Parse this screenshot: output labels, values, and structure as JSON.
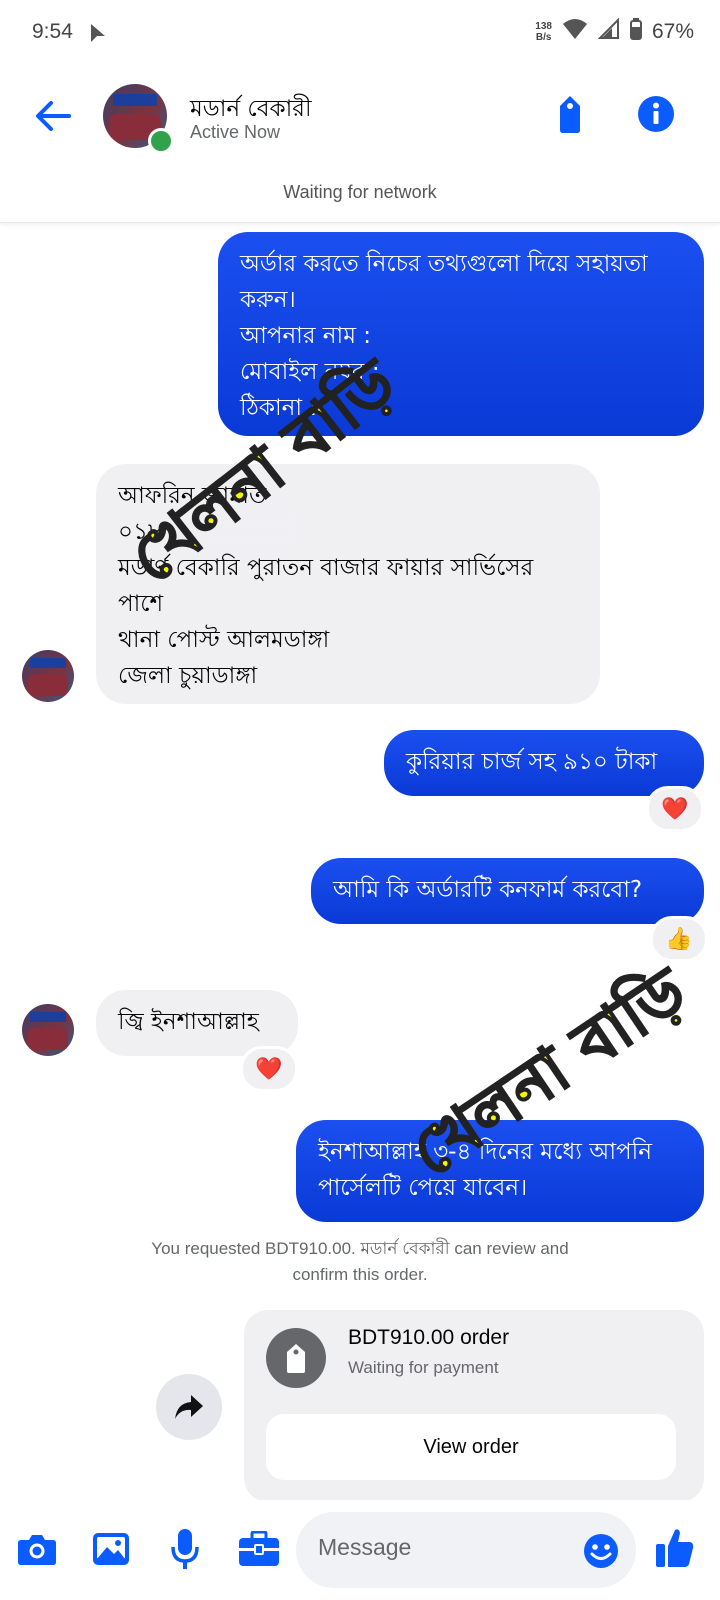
{
  "status_bar": {
    "time": "9:54",
    "net_speed_top": "138",
    "net_speed_bottom": "B/s",
    "battery": "67%"
  },
  "header": {
    "name": "মডার্ন বেকারী",
    "status": "Active Now"
  },
  "network_notice": "Waiting for network",
  "messages": [
    {
      "dir": "out",
      "lines": [
        "অর্ডার করতে নিচের তথ্যগুলো দিয়ে সহায়তা",
        "করুন।",
        "আপনার নাম :",
        "মোবাইল নম্বর :",
        "ঠিকানা :"
      ]
    },
    {
      "dir": "in",
      "lines": [
        "আফরিন জান্নাত",
        "০১৮",
        "মডার্ণ বেকারি পুরাতন বাজার ফায়ার সার্ভিসের",
        "পাশে",
        "থানা পোস্ট আলমডাঙ্গা",
        "জেলা চুয়াডাঙ্গা"
      ]
    },
    {
      "dir": "out",
      "lines": [
        "কুরিয়ার চার্জ সহ ৯১০ টাকা"
      ],
      "reaction": "❤️"
    },
    {
      "dir": "out",
      "lines": [
        "আমি কি অর্ডারটি কনফার্ম করবো?"
      ],
      "reaction": "👍"
    },
    {
      "dir": "in",
      "lines": [
        "জ্বি ইনশাআল্লাহ"
      ],
      "reaction": "❤️"
    },
    {
      "dir": "out",
      "lines": [
        "ইনশাআল্লাহ ৩-৪ দিনের মধ্যে আপনি",
        "পার্সেলটি পেয়ে যাবেন।"
      ]
    }
  ],
  "request_notice": {
    "line1": "You requested BDT910.00. মডার্ন বেকারী can review and",
    "line2": "confirm this order."
  },
  "order_card": {
    "title": "BDT910.00 order",
    "status": "Waiting for payment",
    "button": "View order"
  },
  "watermark_text": "খেলনা বাড়ি",
  "composer": {
    "placeholder": "Message"
  },
  "icons": [
    "back-arrow-icon",
    "tag-icon",
    "info-icon",
    "camera-icon",
    "gallery-icon",
    "microphone-icon",
    "toolbox-icon",
    "emoji-icon",
    "like-icon",
    "share-icon"
  ],
  "colors": {
    "accent": "#0a5cff",
    "bubble_out": "#1b4ff0",
    "bubble_in": "#f0f0f3",
    "online": "#31a24c"
  }
}
